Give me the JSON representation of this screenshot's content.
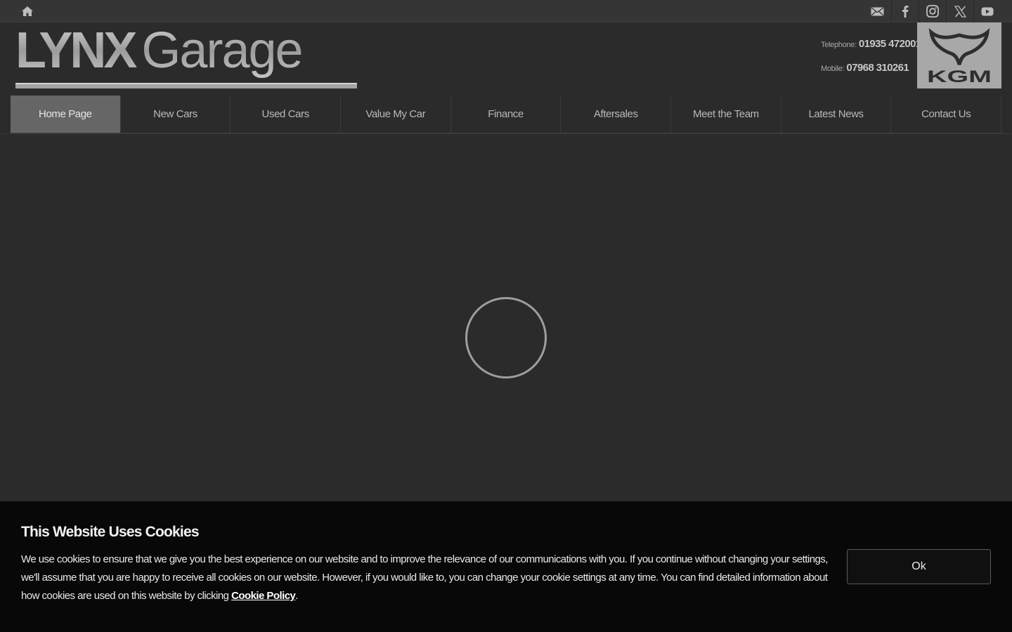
{
  "header": {
    "logo_text": "LYNX Garage",
    "telephone_label": "Telephone:",
    "telephone_number": "01935 472001",
    "mobile_label": "Mobile:",
    "mobile_number": "07968 310261",
    "brand_logo_text": "KGM"
  },
  "topbar": {
    "icons": [
      "home-icon",
      "email-icon",
      "facebook-icon",
      "instagram-icon",
      "x-icon",
      "youtube-icon"
    ]
  },
  "nav": {
    "items": [
      {
        "label": "Home Page",
        "active": true
      },
      {
        "label": "New Cars"
      },
      {
        "label": "Used Cars"
      },
      {
        "label": "Value My Car"
      },
      {
        "label": "Finance"
      },
      {
        "label": "Aftersales"
      },
      {
        "label": "Meet the Team"
      },
      {
        "label": "Latest News"
      },
      {
        "label": "Contact Us"
      }
    ]
  },
  "cookie": {
    "title": "This Website Uses Cookies",
    "text_before_link": "We use cookies to ensure that we give you the best experience on our website and to improve the relevance of our communications with you. If you continue without changing your settings, we'll assume that you are happy to receive all cookies on our website. However, if you would like to, you can change your cookie settings at any time. You can find detailed information about how cookies are used on this website by clicking ",
    "link_label": "Cookie Policy",
    "text_after_link": ".",
    "ok_label": "Ok"
  },
  "colors": {
    "background": "#2b2b2b",
    "topbar": "#353535",
    "nav_active": "#666666",
    "cookie_bg": "#080808"
  }
}
